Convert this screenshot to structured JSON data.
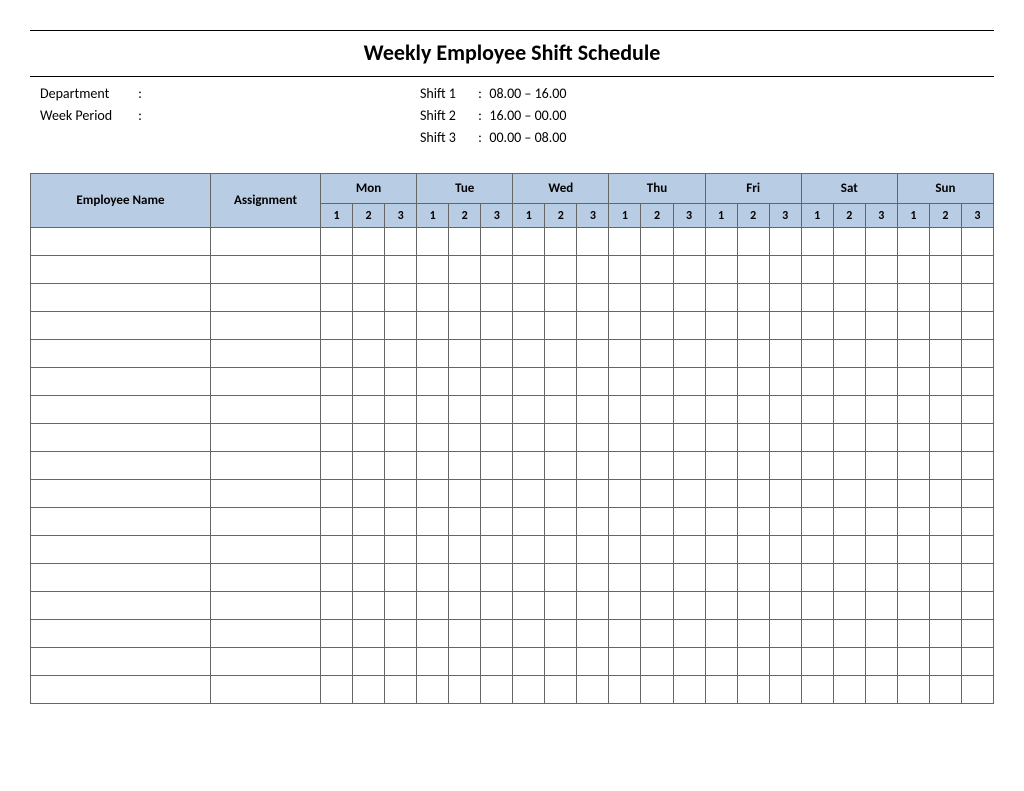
{
  "title": "Weekly Employee Shift Schedule",
  "meta": {
    "department_label": "Department",
    "department_value": "",
    "week_period_label": "Week  Period",
    "week_period_value": "",
    "colon": ":",
    "shifts": [
      {
        "label": "Shift 1",
        "time": "08.00  – 16.00"
      },
      {
        "label": "Shift 2",
        "time": "16.00  – 00.00"
      },
      {
        "label": "Shift 3",
        "time": "00.00  – 08.00"
      }
    ]
  },
  "headers": {
    "employee_name": "Employee Name",
    "assignment": "Assignment",
    "days": [
      "Mon",
      "Tue",
      "Wed",
      "Thu",
      "Fri",
      "Sat",
      "Sun"
    ],
    "shift_nums": [
      "1",
      "2",
      "3"
    ]
  },
  "row_count": 17
}
